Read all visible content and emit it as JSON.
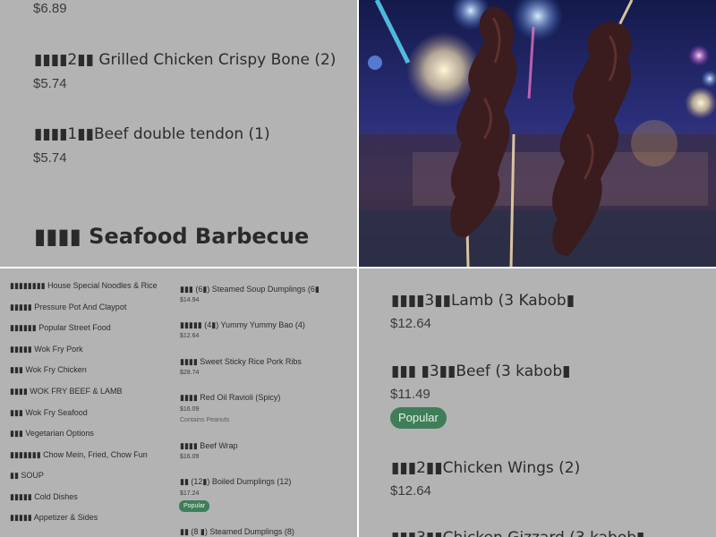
{
  "top_left": {
    "prev_price": "$6.89",
    "items": [
      {
        "name": "▮▮▮▮2▮▮ Grilled Chicken Crispy Bone (2)",
        "price": "$5.74"
      },
      {
        "name": "▮▮▮▮1▮▮Beef double tendon (1)",
        "price": "$5.74"
      }
    ],
    "section_title": "▮▮▮▮ Seafood Barbecue"
  },
  "photo": {
    "description_icon": "kebab-skewers-photo-icon"
  },
  "categories": [
    "▮▮▮▮▮▮▮▮ House Special Noodles & Rice",
    "▮▮▮▮▮ Pressure Pot And Claypot",
    "▮▮▮▮▮▮ Popular Street Food",
    "▮▮▮▮▮ Wok Fry Pork",
    "▮▮▮ Wok Fry Chicken",
    "▮▮▮▮ WOK FRY BEEF & LAMB",
    "▮▮▮ Wok Fry Seafood",
    "▮▮▮ Vegetarian Options",
    "▮▮▮▮▮▮▮ Chow Mein, Fried, Chow Fun",
    "▮▮ SOUP",
    "▮▮▮▮▮ Cold Dishes",
    "▮▮▮▮▮ Appetizer & Sides"
  ],
  "mid_items": [
    {
      "name": "▮▮▮ (6▮) Steamed Soup Dumplings (6▮",
      "price": "$14.94",
      "note": "",
      "badge": ""
    },
    {
      "name": "▮▮▮▮▮ (4▮) Yummy Yummy Bao (4)",
      "price": "$12.64",
      "note": "",
      "badge": ""
    },
    {
      "name": "▮▮▮▮ Sweet Sticky Rice Pork Ribs",
      "price": "$28.74",
      "note": "",
      "badge": ""
    },
    {
      "name": "▮▮▮▮ Red Oil Ravioli (Spicy)",
      "price": "$16.09",
      "note": "Contains Peanuts",
      "badge": ""
    },
    {
      "name": "▮▮▮▮ Beef Wrap",
      "price": "$16.09",
      "note": "",
      "badge": ""
    },
    {
      "name": "▮▮ (12▮) Boiled Dumplings (12)",
      "price": "$17.24",
      "note": "",
      "badge": "Popular"
    },
    {
      "name": "▮▮ (8 ▮) Steamed Dumplings (8)",
      "price": "",
      "note": "",
      "badge": ""
    }
  ],
  "right_items": [
    {
      "name": "▮▮▮▮3▮▮Lamb (3 Kabob▮",
      "price": "$12.64",
      "badge": ""
    },
    {
      "name": "▮▮▮ ▮3▮▮Beef (3 kabob▮",
      "price": "$11.49",
      "badge": "Popular"
    },
    {
      "name": "▮▮▮2▮▮Chicken Wings (2)",
      "price": "$12.64",
      "badge": ""
    },
    {
      "name": "▮▮▮3▮▮Chicken Gizzard (3 kabob▮",
      "price": "",
      "badge": ""
    }
  ],
  "colors": {
    "panel_bg": "#b3b3b3",
    "badge_green": "#3f7e58"
  }
}
